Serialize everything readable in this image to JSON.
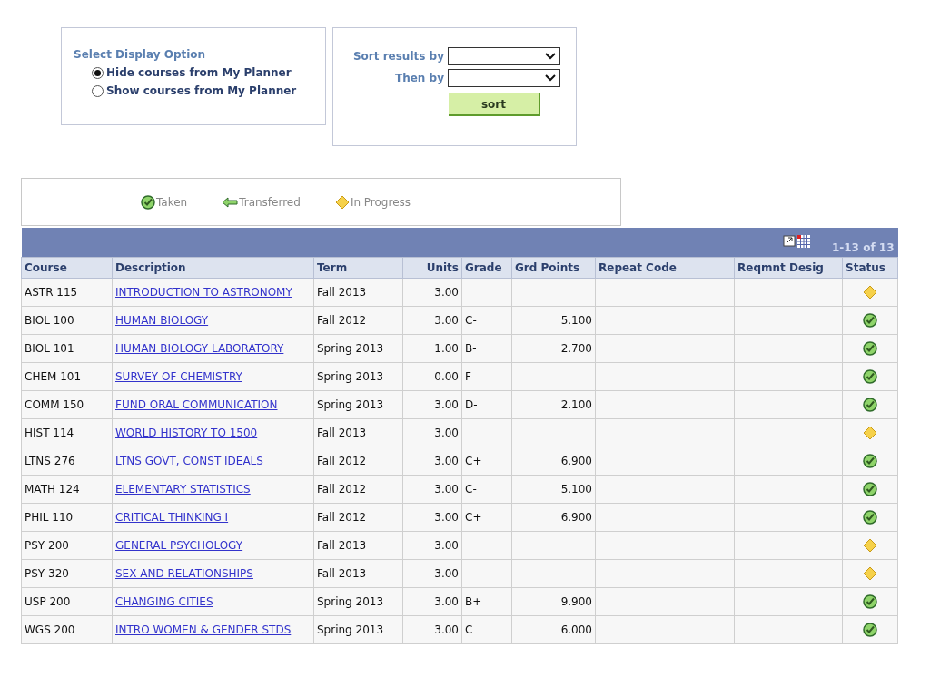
{
  "display_option": {
    "title": "Select Display Option",
    "options": [
      {
        "label": "Hide courses from My Planner",
        "selected": true
      },
      {
        "label": "Show courses from My Planner",
        "selected": false
      }
    ]
  },
  "sort": {
    "fields": [
      {
        "label": "Sort results by"
      },
      {
        "label": "Then by"
      }
    ],
    "button": "sort"
  },
  "legend": [
    {
      "kind": "taken",
      "label": "Taken"
    },
    {
      "kind": "transferred",
      "label": "Transferred"
    },
    {
      "kind": "in_progress",
      "label": "In Progress"
    }
  ],
  "table": {
    "pager": "1-13 of 13",
    "columns": [
      "Course",
      "Description",
      "Term",
      "Units",
      "Grade",
      "Grd Points",
      "Repeat Code",
      "Reqmnt Desig",
      "Status"
    ],
    "rows": [
      {
        "course": "ASTR 115",
        "description": "INTRODUCTION TO ASTRONOMY",
        "term": "Fall 2013",
        "units": "3.00",
        "kind": "in_progress"
      },
      {
        "course": "BIOL 100",
        "description": "HUMAN BIOLOGY",
        "term": "Fall 2012",
        "units": "3.00",
        "grade": "C-",
        "grd_points": "5.100",
        "kind": "taken"
      },
      {
        "course": "BIOL 101",
        "description": "HUMAN BIOLOGY LABORATORY",
        "term": "Spring 2013",
        "units": "1.00",
        "grade": "B-",
        "grd_points": "2.700",
        "kind": "taken"
      },
      {
        "course": "CHEM 101",
        "description": "SURVEY OF CHEMISTRY",
        "term": "Spring 2013",
        "units": "0.00",
        "grade": "F",
        "kind": "taken"
      },
      {
        "course": "COMM 150",
        "description": "FUND ORAL COMMUNICATION",
        "term": "Spring 2013",
        "units": "3.00",
        "grade": "D-",
        "grd_points": "2.100",
        "kind": "taken"
      },
      {
        "course": "HIST 114",
        "description": "WORLD HISTORY TO 1500",
        "term": "Fall 2013",
        "units": "3.00",
        "kind": "in_progress"
      },
      {
        "course": "LTNS 276",
        "description": "LTNS GOVT, CONST IDEALS",
        "term": "Fall 2012",
        "units": "3.00",
        "grade": "C+",
        "grd_points": "6.900",
        "kind": "taken"
      },
      {
        "course": "MATH 124",
        "description": "ELEMENTARY STATISTICS",
        "term": "Fall 2012",
        "units": "3.00",
        "grade": "C-",
        "grd_points": "5.100",
        "kind": "taken"
      },
      {
        "course": "PHIL 110",
        "description": "CRITICAL THINKING I",
        "term": "Fall 2012",
        "units": "3.00",
        "grade": "C+",
        "grd_points": "6.900",
        "kind": "taken"
      },
      {
        "course": "PSY 200",
        "description": "GENERAL PSYCHOLOGY",
        "term": "Fall 2013",
        "units": "3.00",
        "kind": "in_progress"
      },
      {
        "course": "PSY 320",
        "description": "SEX AND RELATIONSHIPS",
        "term": "Fall 2013",
        "units": "3.00",
        "kind": "in_progress"
      },
      {
        "course": "USP 200",
        "description": "CHANGING CITIES",
        "term": "Spring 2013",
        "units": "3.00",
        "grade": "B+",
        "grd_points": "9.900",
        "kind": "taken"
      },
      {
        "course": "WGS 200",
        "description": "INTRO WOMEN & GENDER STDS",
        "term": "Spring 2013",
        "units": "3.00",
        "grade": "C",
        "grd_points": "6.000",
        "kind": "taken"
      }
    ]
  }
}
